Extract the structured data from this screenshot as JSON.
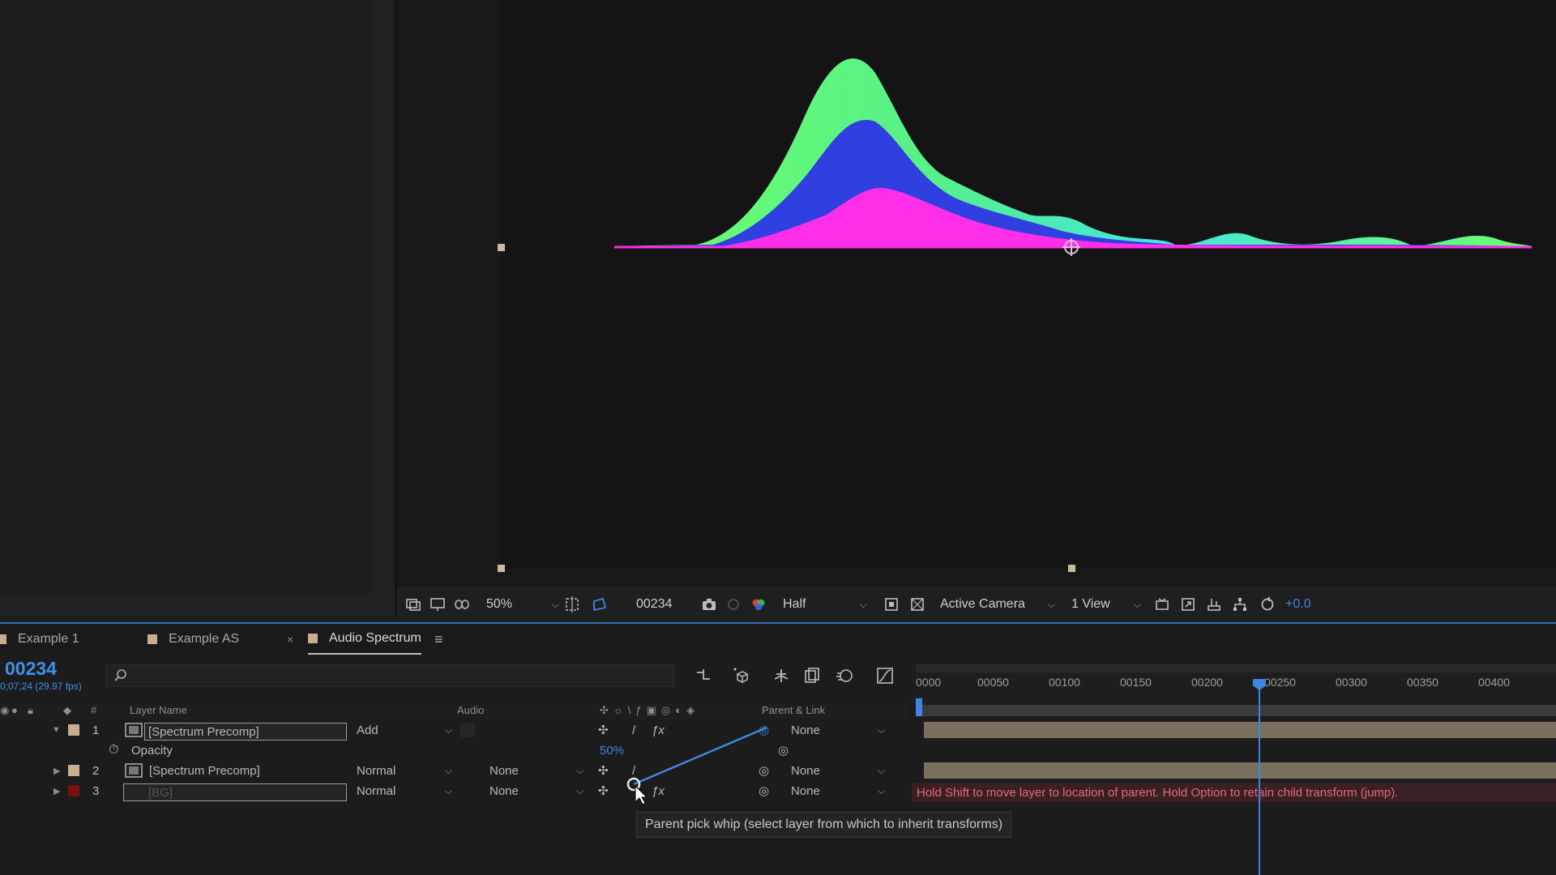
{
  "viewer": {
    "toolbar": {
      "zoom": "50%",
      "frame": "00234",
      "resolution": "Half",
      "camera": "Active Camera",
      "views": "1 View",
      "exposure": "+0.0"
    },
    "colors": {
      "green": "#6dff6a",
      "blue": "#2f3fe0",
      "magenta": "#ff2ee8",
      "cyan": "#43e6e0"
    }
  },
  "tabs": [
    {
      "label": "Example 1"
    },
    {
      "label": "Example AS"
    },
    {
      "label": "Audio Spectrum",
      "active": true
    }
  ],
  "timeline": {
    "timecode": "00234",
    "fps_label": "0;07;24 (29.97 fps)",
    "headers": {
      "num": "#",
      "layer_name": "Layer Name",
      "audio": "Audio",
      "parent_link": "Parent & Link"
    },
    "ruler": [
      "0000",
      "00050",
      "00100",
      "00150",
      "00200",
      "00250",
      "00300",
      "00350",
      "00400"
    ],
    "layers": [
      {
        "num": "1",
        "name": "[Spectrum Precomp]",
        "mode": "Add",
        "track_matte": "",
        "parent": "None",
        "color": "#c8ad8f",
        "expanded": true
      },
      {
        "num": "2",
        "name": "[Spectrum Precomp]",
        "mode": "Normal",
        "track_matte": "None",
        "parent": "None",
        "color": "#c8ad8f",
        "expanded": false
      },
      {
        "num": "3",
        "name": "[BG]",
        "mode": "Normal",
        "track_matte": "None",
        "parent": "None",
        "color": "#7a1010",
        "expanded": false
      }
    ],
    "property": {
      "name": "Opacity",
      "value": "50%"
    },
    "warning": "Hold Shift to move layer to location of parent. Hold Option to retain child transform (jump).",
    "tooltip": "Parent pick whip (select layer from which to inherit transforms)"
  }
}
